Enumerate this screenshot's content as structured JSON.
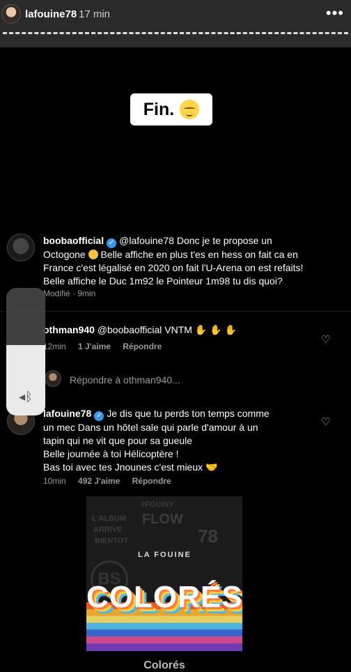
{
  "story": {
    "username": "lafouine78",
    "time": "17 min",
    "more_icon": "more-dots-icon",
    "sticker_text": "Fin."
  },
  "comments": [
    {
      "username": "boobaofficial",
      "verified": true,
      "mention": "@lafouine78",
      "lines": [
        "Donc je te propose un",
        "Octogone",
        "Belle affiche en plus t'es en hess on fait ca en",
        "France c'est légalisé en 2020 on fait l'U-Arena on est refaits!",
        "Belle affiche le Duc 1m92 le Pointeur 1m98 tu dis quoi?"
      ],
      "meta": "Modifié · 9min"
    },
    {
      "username": "othman940",
      "text": "@boobaofficial VNTM",
      "time": "12min",
      "likes": "1 J'aime",
      "reply": "Répondre"
    },
    {
      "reply_prompt": "Répondre à othman940..."
    },
    {
      "username": "lafouine78",
      "verified": true,
      "lines": [
        "Je dis que tu perds ton temps comme",
        "un mec Dans un hôtel sale qui parle d'amour à un",
        "tapin qui ne vit que pour sa gueule",
        "Belle journée à toi Hélicoptère !",
        "Bas toi avec tes Jnounes c'est mieux"
      ],
      "time": "10min",
      "likes": "492 J'aime",
      "reply": "Répondre"
    }
  ],
  "volume": {
    "level": 0.55,
    "icon": "bluetooth-speaker-icon"
  },
  "album": {
    "artist": "LA FOUINE",
    "title": "COLORÉS",
    "caption": "Colorés",
    "scrawls": [
      "L'ALBUM",
      "ARRIVE",
      "BIENTOT",
      "#FOUINY",
      "FLOW",
      "78",
      "BS"
    ]
  }
}
